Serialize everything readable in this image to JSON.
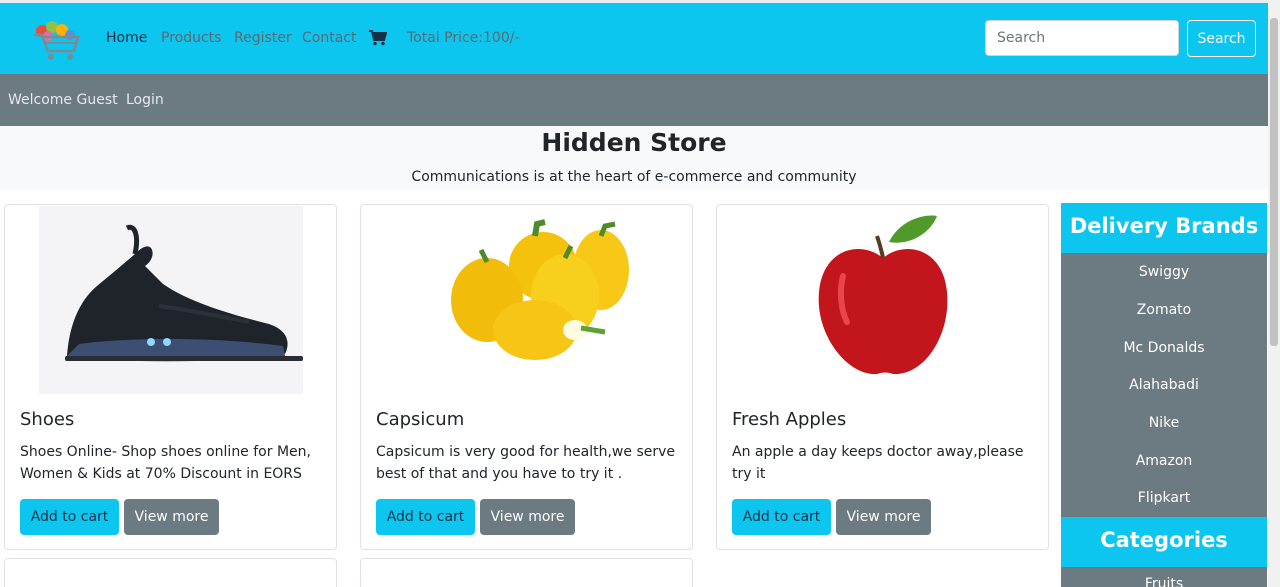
{
  "nav": {
    "links": [
      "Home",
      "Products",
      "Register",
      "Contact"
    ],
    "total_price": "Total Price:100/-",
    "search_placeholder": "Search",
    "search_button": "Search"
  },
  "subbar": {
    "welcome": "Welcome Guest",
    "login": "Login"
  },
  "jumbotron": {
    "title": "Hidden Store",
    "subtitle": "Communications is at the heart of e-commerce and community"
  },
  "products": [
    {
      "title": "Shoes",
      "text": "Shoes Online- Shop shoes online for Men, Women & Kids at 70% Discount in EORS",
      "add_label": "Add to cart",
      "more_label": "View more"
    },
    {
      "title": "Capsicum",
      "text": "Capsicum is very good for health,we serve best of that and you have to try it .",
      "add_label": "Add to cart",
      "more_label": "View more"
    },
    {
      "title": "Fresh Apples",
      "text": "An apple a day keeps doctor away,please try it",
      "add_label": "Add to cart",
      "more_label": "View more"
    }
  ],
  "sidebar": {
    "delivery_heading": "Delivery Brands",
    "brands": [
      "Swiggy",
      "Zomato",
      "Mc Donalds",
      "Alahabadi",
      "Nike",
      "Amazon",
      "Flipkart"
    ],
    "categories_heading": "Categories",
    "categories_partial": "Fruits"
  },
  "colors": {
    "primary": "#0dc6ef",
    "secondary": "#6c7a82",
    "light": "#f8f9fa"
  },
  "icons": {
    "logo": "shopping-cart-logo",
    "cart": "cart-icon"
  }
}
